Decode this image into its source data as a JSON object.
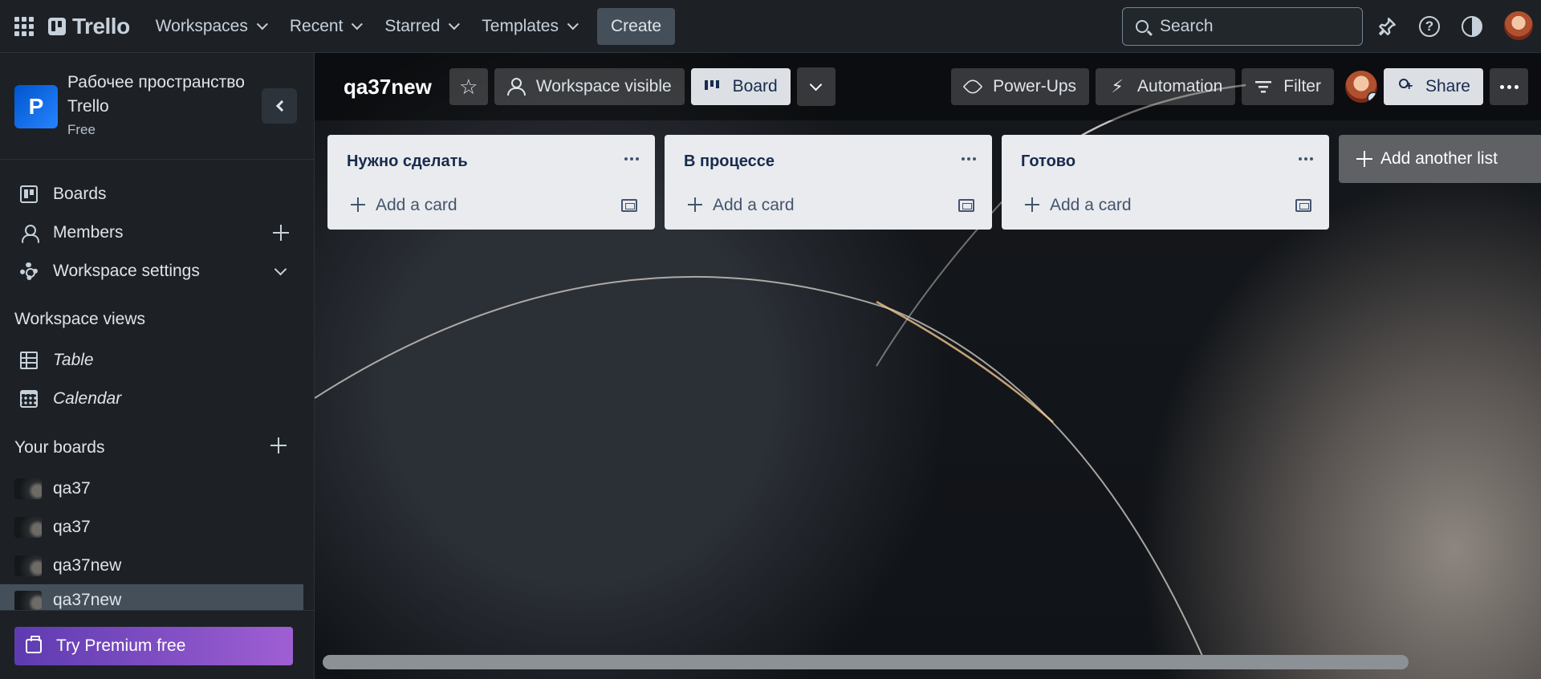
{
  "topbar": {
    "app_name": "Trello",
    "nav": [
      {
        "label": "Workspaces"
      },
      {
        "label": "Recent"
      },
      {
        "label": "Starred"
      },
      {
        "label": "Templates"
      }
    ],
    "create_label": "Create",
    "search_placeholder": "Search"
  },
  "sidebar": {
    "workspace_initial": "P",
    "workspace_name": "Рабочее пространство Trello",
    "workspace_plan": "Free",
    "items": [
      {
        "label": "Boards"
      },
      {
        "label": "Members"
      },
      {
        "label": "Workspace settings"
      }
    ],
    "views_heading": "Workspace views",
    "views": [
      {
        "label": "Table"
      },
      {
        "label": "Calendar"
      }
    ],
    "boards_heading": "Your boards",
    "boards": [
      {
        "label": "qa37"
      },
      {
        "label": "qa37"
      },
      {
        "label": "qa37new"
      },
      {
        "label": "qa37new"
      }
    ],
    "premium_label": "Try Premium free"
  },
  "board": {
    "title": "qa37new",
    "visibility_label": "Workspace visible",
    "view_label": "Board",
    "powerups_label": "Power-Ups",
    "automation_label": "Automation",
    "filter_label": "Filter",
    "share_label": "Share",
    "lists": [
      {
        "title": "Нужно сделать",
        "add_card_label": "Add a card"
      },
      {
        "title": "В процессе",
        "add_card_label": "Add a card"
      },
      {
        "title": "Готово",
        "add_card_label": "Add a card"
      }
    ],
    "add_list_label": "Add another list"
  }
}
